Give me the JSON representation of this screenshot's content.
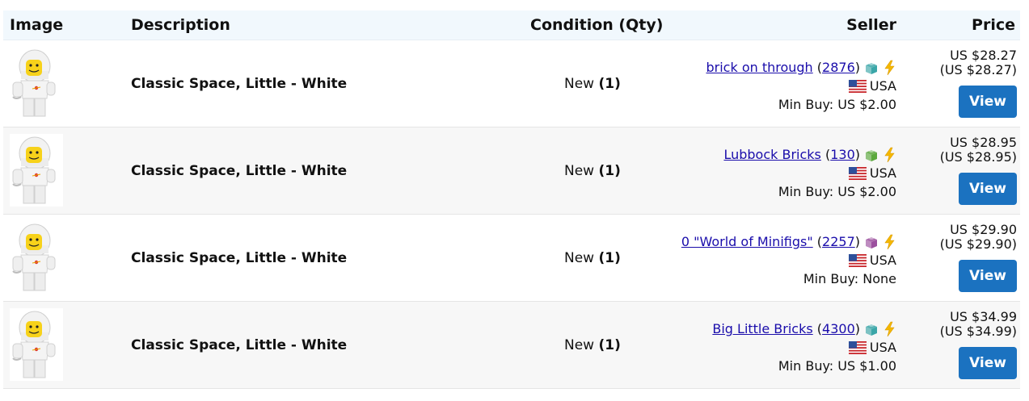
{
  "headers": {
    "image": "Image",
    "description": "Description",
    "condition": "Condition (Qty)",
    "seller": "Seller",
    "price": "Price"
  },
  "colors": {
    "link": "#1a0dab",
    "button": "#1b72c0",
    "header_bg": "#f1f8fd",
    "alt_row_bg": "#f7f7f7"
  },
  "rows": [
    {
      "description": "Classic Space, Little - White",
      "condition": "New",
      "qty": "(1)",
      "seller_name": "brick on through",
      "feedback": "2876",
      "store_icon": "teal-brick-icon",
      "country": "USA",
      "min_buy": "Min Buy: US $2.00",
      "price": "US $28.27",
      "price_converted": "(US $28.27)",
      "button": "View"
    },
    {
      "description": "Classic Space, Little - White",
      "condition": "New",
      "qty": "(1)",
      "seller_name": "Lubbock Bricks",
      "feedback": "130",
      "store_icon": "green-brick-icon",
      "country": "USA",
      "min_buy": "Min Buy: US $2.00",
      "price": "US $28.95",
      "price_converted": "(US $28.95)",
      "button": "View"
    },
    {
      "description": "Classic Space, Little - White",
      "condition": "New",
      "qty": "(1)",
      "seller_name": "0 \"World of Minifigs\"",
      "feedback": "2257",
      "store_icon": "purple-brick-icon",
      "country": "USA",
      "min_buy": "Min Buy: None",
      "price": "US $29.90",
      "price_converted": "(US $29.90)",
      "button": "View"
    },
    {
      "description": "Classic Space, Little - White",
      "condition": "New",
      "qty": "(1)",
      "seller_name": "Big Little Bricks",
      "feedback": "4300",
      "store_icon": "teal-brick-icon",
      "country": "USA",
      "min_buy": "Min Buy: US $1.00",
      "price": "US $34.99",
      "price_converted": "(US $34.99)",
      "button": "View"
    }
  ]
}
